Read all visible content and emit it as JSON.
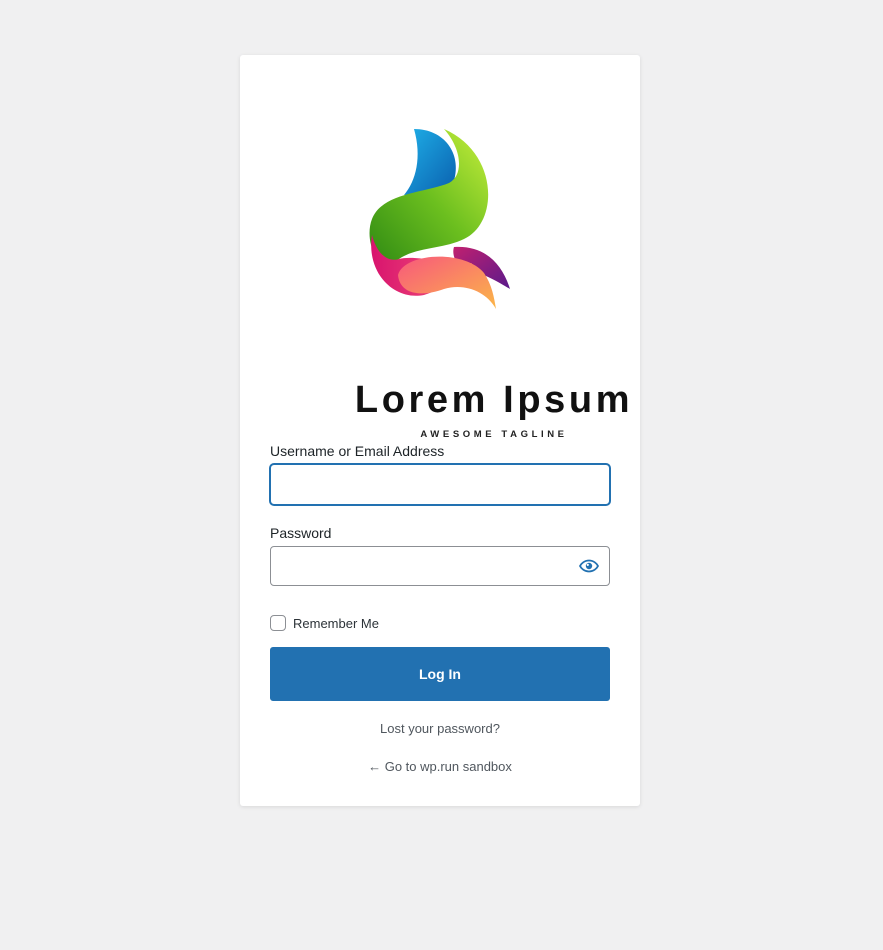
{
  "logo": {
    "name": "Lorem Ipsum",
    "tagline": "AWESOME TAGLINE"
  },
  "form": {
    "username_label": "Username or Email Address",
    "username_value": "",
    "password_label": "Password",
    "password_value": "",
    "password_toggle_icon": "eye-icon",
    "remember_label": "Remember Me",
    "remember_checked": false,
    "submit_label": "Log In"
  },
  "links": {
    "lost_password": "Lost your password?",
    "back_to_site": "← Go to wp.run sandbox"
  },
  "colors": {
    "primary": "#2271b1",
    "background": "#f0f0f1",
    "card": "#ffffff"
  }
}
